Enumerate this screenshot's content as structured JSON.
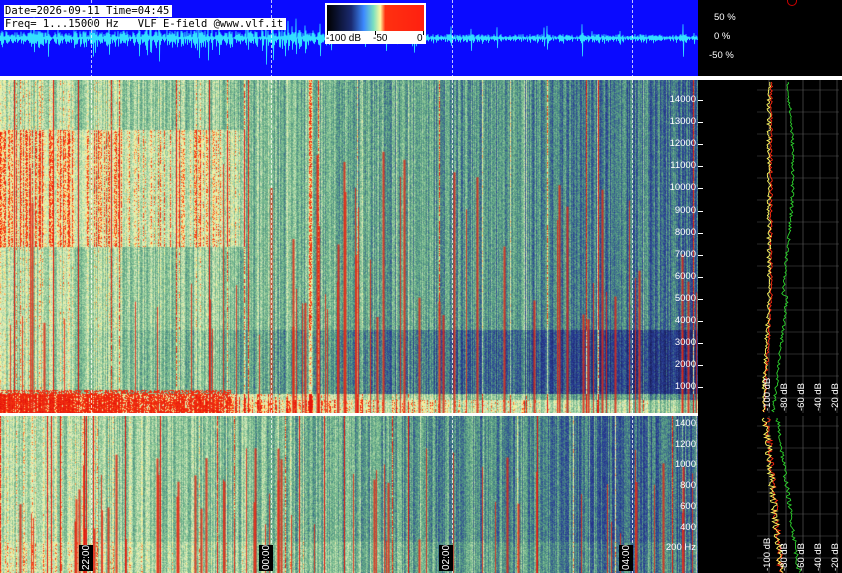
{
  "header": {
    "line1": "Date=2026-09-11 Time=04:45",
    "line2": "Freq= 1...15000 Hz   VLF E-field @www.vlf.it"
  },
  "colorbar": {
    "labels": [
      "-100 dB",
      "-50",
      "0"
    ]
  },
  "waveform": {
    "percent_labels": [
      "50 %",
      "0 %",
      "-50 %"
    ]
  },
  "spectrogram_top": {
    "freq_labels": [
      "14000",
      "13000",
      "12000",
      "11000",
      "10000",
      "9000",
      "8000",
      "7000",
      "6000",
      "5000",
      "4000",
      "3000",
      "2000",
      "1000"
    ]
  },
  "spectrogram_bottom": {
    "freq_labels": [
      "1400",
      "1200",
      "1000",
      "800",
      "600",
      "400",
      "200 Hz"
    ]
  },
  "time_labels": [
    "22:00",
    "00:00",
    "02:00",
    "04:00"
  ],
  "profile_top": {
    "db_labels": [
      "-100 dB",
      "-80 dB",
      "-60 dB",
      "-40 dB",
      "-20 dB"
    ]
  },
  "profile_bottom": {
    "db_labels": [
      "-100 dB",
      "-80 dB",
      "-60 dB",
      "-40 dB",
      "-20 dB"
    ]
  },
  "colors": {
    "waveform_bg": "#0a0aff",
    "waveform_trace": "#33e0ff",
    "spectrum_green": "#2cd22c",
    "spectrum_red": "#ff2a10",
    "spectrum_yellow": "#fffa60"
  }
}
